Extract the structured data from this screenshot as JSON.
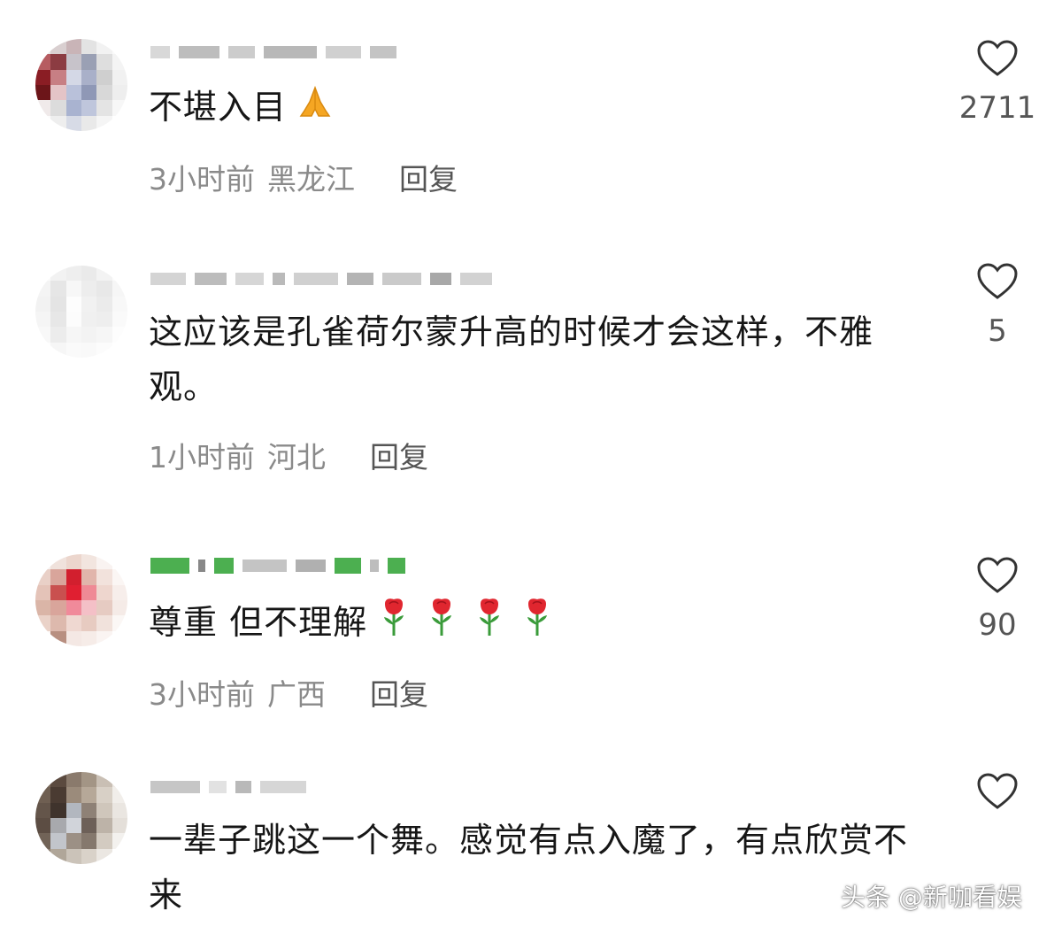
{
  "comments": [
    {
      "text": "不堪入目",
      "emoji": "folded-hands-icon",
      "time": "3小时前",
      "region": "黑龙江",
      "reply_label": "回复",
      "likes": "2711"
    },
    {
      "text": "这应该是孔雀荷尔蒙升高的时候才会这样，不雅观。",
      "time": "1小时前",
      "region": "河北",
      "reply_label": "回复",
      "likes": "5"
    },
    {
      "text": "尊重 但不理解",
      "emoji": "rose-icon",
      "emoji_count": 4,
      "time": "3小时前",
      "region": "广西",
      "reply_label": "回复",
      "likes": "90"
    },
    {
      "text": "一辈子跳这一个舞。感觉有点入魔了，有点欣赏不来"
    }
  ],
  "watermark": "头条 @新咖看娱",
  "colors": {
    "text": "#161616",
    "meta": "#8a8a8a",
    "reply": "#555555",
    "heart_outline": "#333333"
  }
}
